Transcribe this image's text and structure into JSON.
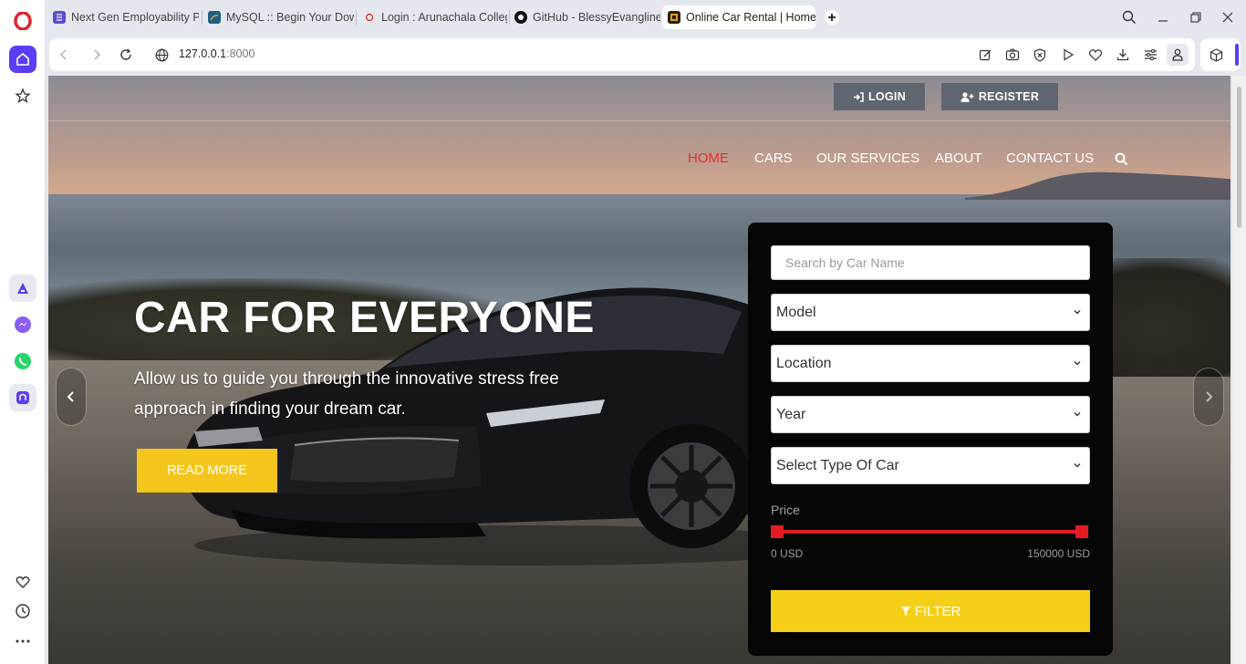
{
  "browser": {
    "tabs": [
      {
        "label": "Next Gen Employability Pr",
        "icon": "list-icon"
      },
      {
        "label": "MySQL :: Begin Your Down",
        "icon": "mysql-icon"
      },
      {
        "label": "Login : Arunachala College",
        "icon": "college-icon"
      },
      {
        "label": "GitHub - BlessyEvangline/",
        "icon": "github-icon"
      },
      {
        "label": "Online Car Rental | Home",
        "icon": "site-icon",
        "active": true
      }
    ],
    "url_host": "127.0.0.1",
    "url_port": ":8000"
  },
  "header": {
    "login_label": "LOGIN",
    "register_label": "REGISTER"
  },
  "nav": {
    "items": [
      "HOME",
      "CARS",
      "OUR SERVICES",
      "ABOUT",
      "CONTACT US"
    ],
    "active": "HOME"
  },
  "hero": {
    "title": "CAR FOR EVERYONE",
    "subtitle": "Allow us to guide you through the innovative stress free approach in finding your dream car.",
    "cta_label": "READ MORE"
  },
  "filter": {
    "search_placeholder": "Search by Car Name",
    "model": "Model",
    "location": "Location",
    "year": "Year",
    "car_type": "Select Type Of Car",
    "price_label": "Price",
    "price_min": "0 USD",
    "price_max": "150000 USD",
    "button_label": "FILTER"
  },
  "colors": {
    "accent_yellow": "#f5cf17",
    "accent_red": "#e31c24",
    "nav_active": "#e3302b"
  }
}
